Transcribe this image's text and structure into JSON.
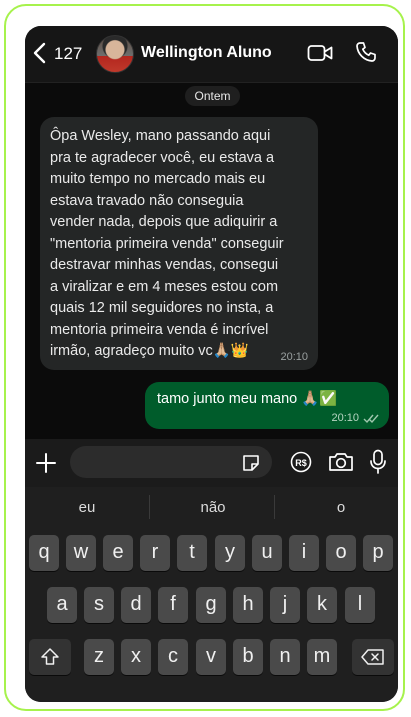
{
  "header": {
    "back_count": "127",
    "contact_name": "Wellington Aluno"
  },
  "chat": {
    "date_label": "Ontem",
    "incoming": {
      "text": "Ôpa Wesley, mano passando aqui\npra te agradecer você, eu estava a\nmuito tempo no mercado mais eu\nestava travado não conseguia\nvender nada, depois que adiquirir a\n\"mentoria primeira venda\" conseguir\ndestravar minhas vendas, consegui\na viralizar e em 4 meses estou com\nquais 12 mil seguidores no insta, a\nmentoria primeira venda é incrível\nirmão, agradeço muito vc🙏🏼👑",
      "time": "20:10"
    },
    "outgoing": {
      "text": "tamo junto meu mano 🙏🏼✅",
      "time": "20:10"
    }
  },
  "input_bar": {
    "placeholder": ""
  },
  "keyboard": {
    "suggestions": [
      "eu",
      "não",
      "o"
    ],
    "row1": [
      "q",
      "w",
      "e",
      "r",
      "t",
      "y",
      "u",
      "i",
      "o",
      "p"
    ],
    "row2": [
      "a",
      "s",
      "d",
      "f",
      "g",
      "h",
      "j",
      "k",
      "l"
    ],
    "row3": [
      "z",
      "x",
      "c",
      "v",
      "b",
      "n",
      "m"
    ]
  },
  "icons": {
    "back": "chevron-left-icon",
    "video": "video-camera-icon",
    "phone": "phone-icon",
    "plus": "plus-icon",
    "sticker": "sticker-icon",
    "pix": "pix-icon",
    "camera": "camera-icon",
    "mic": "microphone-icon",
    "shift": "shift-icon",
    "backspace": "backspace-icon",
    "read": "double-check-icon"
  },
  "colors": {
    "accent_border": "#a6f24c",
    "incoming_bubble": "#242626",
    "outgoing_bubble": "#005c2b",
    "read_ticks": "#9fc7ae"
  }
}
